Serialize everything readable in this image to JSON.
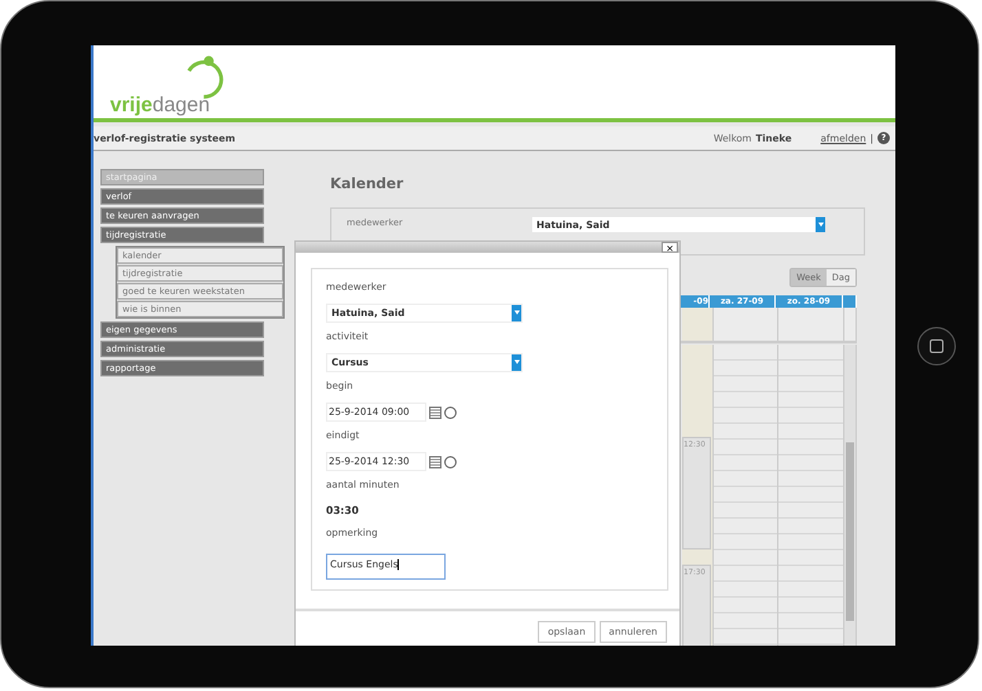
{
  "header": {
    "logo": {
      "part_1": "vrije",
      "part_2": "dagen"
    }
  },
  "topbar": {
    "title": "verlof-registratie systeem",
    "welcome": "Welkom",
    "user": "Tineke",
    "logout": "afmelden",
    "separator": "|",
    "help": "?"
  },
  "sidebar": {
    "items": [
      {
        "label": "startpagina",
        "disabled": true
      },
      {
        "label": "verlof",
        "disabled": false
      },
      {
        "label": "te keuren aanvragen",
        "disabled": false
      },
      {
        "label": "tijdregistratie",
        "disabled": false,
        "children": [
          {
            "label": "kalender"
          },
          {
            "label": "tijdregistratie"
          },
          {
            "label": "goed te keuren weekstaten"
          },
          {
            "label": "wie is binnen"
          }
        ]
      },
      {
        "label": "eigen gegevens",
        "disabled": false
      },
      {
        "label": "administratie",
        "disabled": false
      },
      {
        "label": "rapportage",
        "disabled": false
      }
    ]
  },
  "main": {
    "title": "Kalender",
    "filter": {
      "label": "medewerker",
      "value": "Hatuina, Said"
    },
    "view_buttons": [
      {
        "label": "Week",
        "selected": true
      },
      {
        "label": "Dag",
        "selected": false
      }
    ],
    "calendar": {
      "columns": [
        {
          "label": "-09",
          "highlighted": true
        },
        {
          "label": "za. 27-09",
          "highlighted": false
        },
        {
          "label": "zo. 28-09",
          "highlighted": false
        }
      ],
      "events": [
        {
          "time": "12:30"
        },
        {
          "time": "17:30"
        }
      ]
    }
  },
  "dialog": {
    "close": "×",
    "fields": [
      {
        "kind": "select",
        "label": "medewerker",
        "value": "Hatuina, Said"
      },
      {
        "kind": "select",
        "label": "activiteit",
        "value": "Cursus"
      },
      {
        "kind": "datetime",
        "label": "begin",
        "value": "25-9-2014 09:00"
      },
      {
        "kind": "datetime",
        "label": "eindigt",
        "value": "25-9-2014 12:30"
      },
      {
        "kind": "static",
        "label": "aantal minuten",
        "value": "03:30"
      },
      {
        "kind": "textarea",
        "label": "opmerking",
        "value": "Cursus Engels"
      }
    ],
    "buttons": [
      "opslaan",
      "annuleren"
    ]
  }
}
